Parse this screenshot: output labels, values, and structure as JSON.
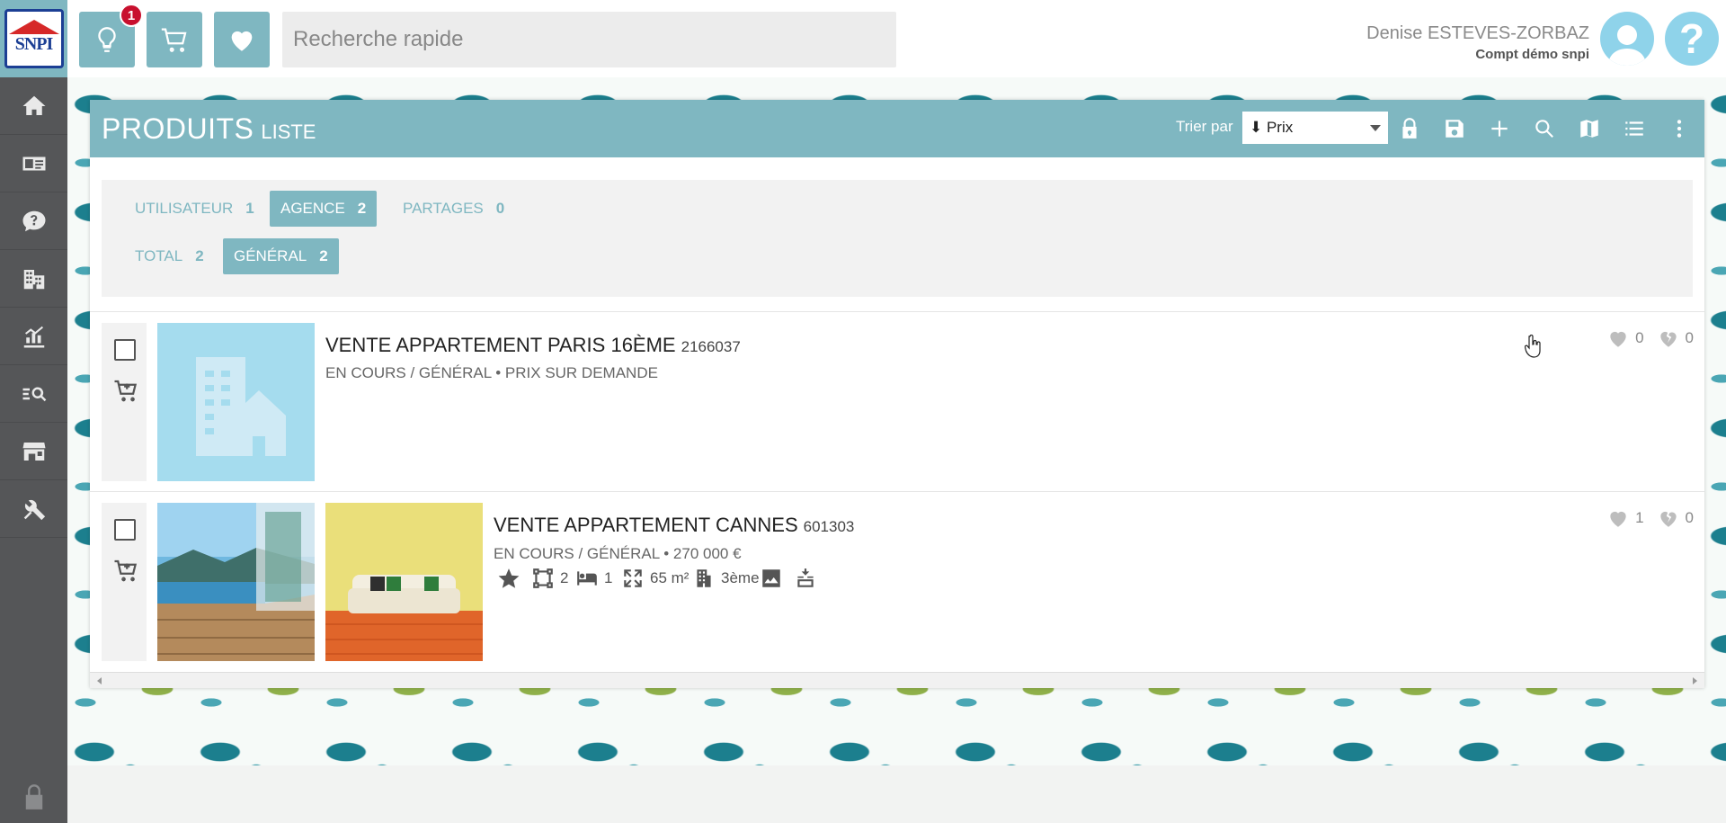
{
  "header": {
    "logo_text": "SNPI",
    "notifications_count": "1",
    "search_placeholder": "Recherche rapide",
    "user_name": "Denise ESTEVES-ZORBAZ",
    "user_account": "Compt démo snpi",
    "help_symbol": "?"
  },
  "sidebar": {
    "items": [
      "home-icon",
      "id-card-icon",
      "chat-help-icon",
      "buildings-icon",
      "chart-icon",
      "search-list-icon",
      "store-icon",
      "tools-icon"
    ],
    "bottom_icon": "lock-icon"
  },
  "panel": {
    "title": "PRODUITS",
    "subtitle": "LISTE",
    "sort_label": "Trier par",
    "sort_value": "⬇ Prix",
    "toolbar_icons": [
      "lock-icon",
      "save-icon",
      "plus-icon",
      "search-icon",
      "map-icon",
      "list-icon",
      "more-vertical-icon"
    ]
  },
  "filters": {
    "utilisateur": {
      "label": "UTILISATEUR",
      "count": "1"
    },
    "agence": {
      "label": "AGENCE",
      "count": "2",
      "active": true
    },
    "partages": {
      "label": "PARTAGES",
      "count": "0"
    },
    "total": {
      "label": "TOTAL",
      "count": "2"
    },
    "general": {
      "label": "GÉNÉRAL",
      "count": "2",
      "active": true
    }
  },
  "listings": [
    {
      "title": "VENTE APPARTEMENT PARIS 16ÈME",
      "ref": "2166037",
      "status": "EN COURS / GÉNÉRAL • PRIX SUR DEMANDE",
      "likes": "0",
      "dislikes": "0"
    },
    {
      "title": "VENTE APPARTEMENT CANNES",
      "ref": "601303",
      "status": "EN COURS / GÉNÉRAL • 270 000 €",
      "rooms": "2",
      "bedrooms": "1",
      "surface": "65 m²",
      "floor": "3ème",
      "likes": "1",
      "dislikes": "0"
    }
  ],
  "colors": {
    "accent": "#7fb7c1",
    "sidebar": "#555658",
    "placeholder_thumb": "#a5dcee",
    "badge": "#c8102e"
  }
}
